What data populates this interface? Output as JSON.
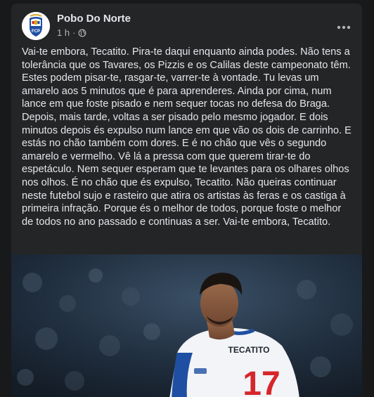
{
  "post": {
    "page_name": "Pobo Do Norte",
    "time": "1 h",
    "visibility_icon": "globe-icon",
    "more_icon": "more-horizontal-icon",
    "text": "Vai-te embora, Tecatito. Pira-te daqui enquanto ainda podes. Não tens a tolerância que os Tavares, os Pizzis e os Calilas deste campeonato têm. Estes podem pisar-te, rasgar-te, varrer-te à vontade. Tu levas um amarelo aos 5 minutos que é para aprenderes. Ainda por cima, num lance em que foste pisado e nem sequer tocas no defesa do Braga. Depois, mais tarde, voltas a ser pisado pelo mesmo jogador. E dois minutos depois és expulso num lance em que vão os dois de carrinho. E estás no chão também com dores. E é no chão que vês o segundo amarelo e vermelho. Vê lá a pressa com que querem tirar-te do espetáculo. Nem sequer esperam que te levantes para os olhares olhos nos olhos. É no chão que és expulso, Tecatito. Não queiras continuar neste futebol sujo e rasteiro que atira os artistas às feras e os castiga à primeira infração. Porque és o melhor de todos, porque foste o melhor de todos no ano passado e continuas a ser. Vai-te embora, Tecatito.",
    "photo": {
      "jersey_name": "TECATITO",
      "jersey_number": "17"
    }
  },
  "colors": {
    "page_bg": "#18191a",
    "card_bg": "#242526",
    "text_primary": "#e4e6eb",
    "text_secondary": "#b0b3b8",
    "jersey_blue": "#1f4fa3",
    "jersey_number_red": "#d7262b"
  }
}
